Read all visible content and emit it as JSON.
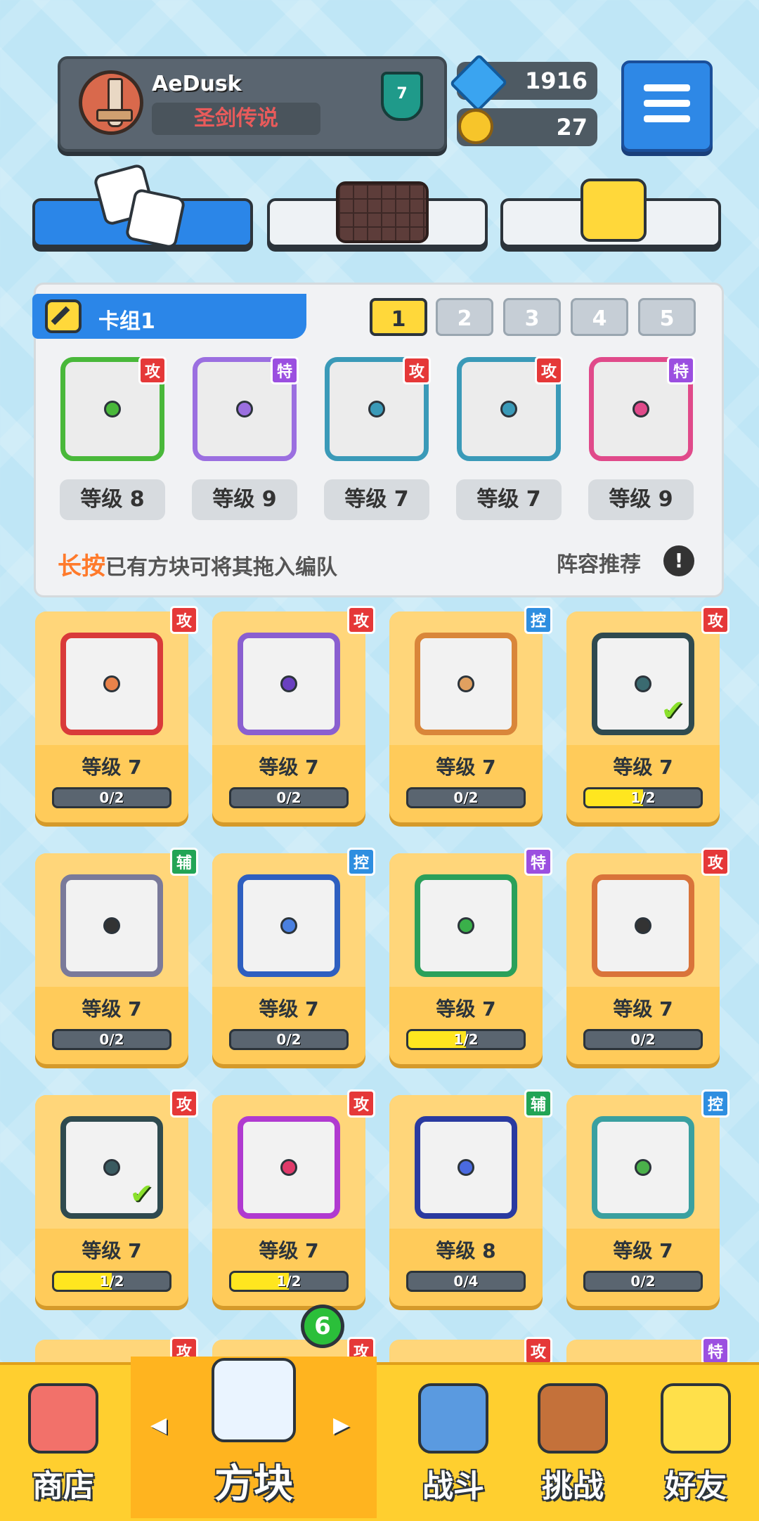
{
  "header": {
    "player_name": "AeDusk",
    "player_title": "圣剑传说",
    "rank": "7",
    "gems": "1916",
    "coins": "27"
  },
  "deck": {
    "title": "卡组1",
    "pages": [
      "1",
      "2",
      "3",
      "4",
      "5"
    ],
    "active_page": "1",
    "cards": [
      {
        "badge": "攻",
        "level": "等级 8",
        "color": "#49b83a"
      },
      {
        "badge": "特",
        "level": "等级 9",
        "color": "#9b6fe0"
      },
      {
        "badge": "攻",
        "level": "等级 7",
        "color": "#3a9ab8"
      },
      {
        "badge": "攻",
        "level": "等级 7",
        "color": "#3a9ab8"
      },
      {
        "badge": "特",
        "level": "等级 9",
        "color": "#e04a8a"
      }
    ],
    "hint_highlight": "长按",
    "hint_rest": "已有方块可将其拖入编队",
    "recommend": "阵容推荐",
    "recommend_icon": "!"
  },
  "grid": [
    {
      "badge": "攻",
      "level": "等级 7",
      "progress": "0/2",
      "fraction": 0,
      "color": "#d93a3a",
      "dot": "#e8824a",
      "checked": false
    },
    {
      "badge": "攻",
      "level": "等级 7",
      "progress": "0/2",
      "fraction": 0,
      "color": "#8a5fd0",
      "dot": "#6a40c0",
      "checked": false
    },
    {
      "badge": "控",
      "level": "等级 7",
      "progress": "0/2",
      "fraction": 0,
      "color": "#d9863a",
      "dot": "#e0a060",
      "checked": false
    },
    {
      "badge": "攻",
      "level": "等级 7",
      "progress": "1/2",
      "fraction": 0.5,
      "color": "#2f4a4f",
      "dot": "#3a6a70",
      "checked": true
    },
    {
      "badge": "辅",
      "level": "等级 7",
      "progress": "0/2",
      "fraction": 0,
      "color": "#7a7a9a",
      "dot": "#333333",
      "checked": false
    },
    {
      "badge": "控",
      "level": "等级 7",
      "progress": "0/2",
      "fraction": 0,
      "color": "#2e5fc0",
      "dot": "#4a80e0",
      "checked": false
    },
    {
      "badge": "特",
      "level": "等级 7",
      "progress": "1/2",
      "fraction": 0.5,
      "color": "#2aa05a",
      "dot": "#3ab04a",
      "checked": false
    },
    {
      "badge": "攻",
      "level": "等级 7",
      "progress": "0/2",
      "fraction": 0,
      "color": "#d9733a",
      "dot": "#333333",
      "checked": false
    },
    {
      "badge": "攻",
      "level": "等级 7",
      "progress": "1/2",
      "fraction": 0.5,
      "color": "#2f4a4f",
      "dot": "#3a5a60",
      "checked": true
    },
    {
      "badge": "攻",
      "level": "等级 7",
      "progress": "1/2",
      "fraction": 0.5,
      "color": "#b03ad0",
      "dot": "#e03a6a",
      "checked": false
    },
    {
      "badge": "辅",
      "level": "等级 8",
      "progress": "0/4",
      "fraction": 0,
      "color": "#2a3aa0",
      "dot": "#4a6ae0",
      "checked": false
    },
    {
      "badge": "控",
      "level": "等级 7",
      "progress": "0/2",
      "fraction": 0,
      "color": "#3aa0a0",
      "dot": "#4ab04a",
      "checked": false
    }
  ],
  "peek_badges": [
    "攻",
    "攻",
    "攻",
    "特"
  ],
  "nav": {
    "shop": "商店",
    "blocks": "方块",
    "battle": "战斗",
    "challenge": "挑战",
    "friends": "好友",
    "blocks_notification": "6",
    "arrow_left": "◀",
    "arrow_right": "▶"
  },
  "colors": {
    "accent": "#2b86e8",
    "gold": "#ffcf2f",
    "attack": "#e53838",
    "special": "#9b4fe0",
    "control": "#2e8ee0",
    "support": "#22a455"
  }
}
